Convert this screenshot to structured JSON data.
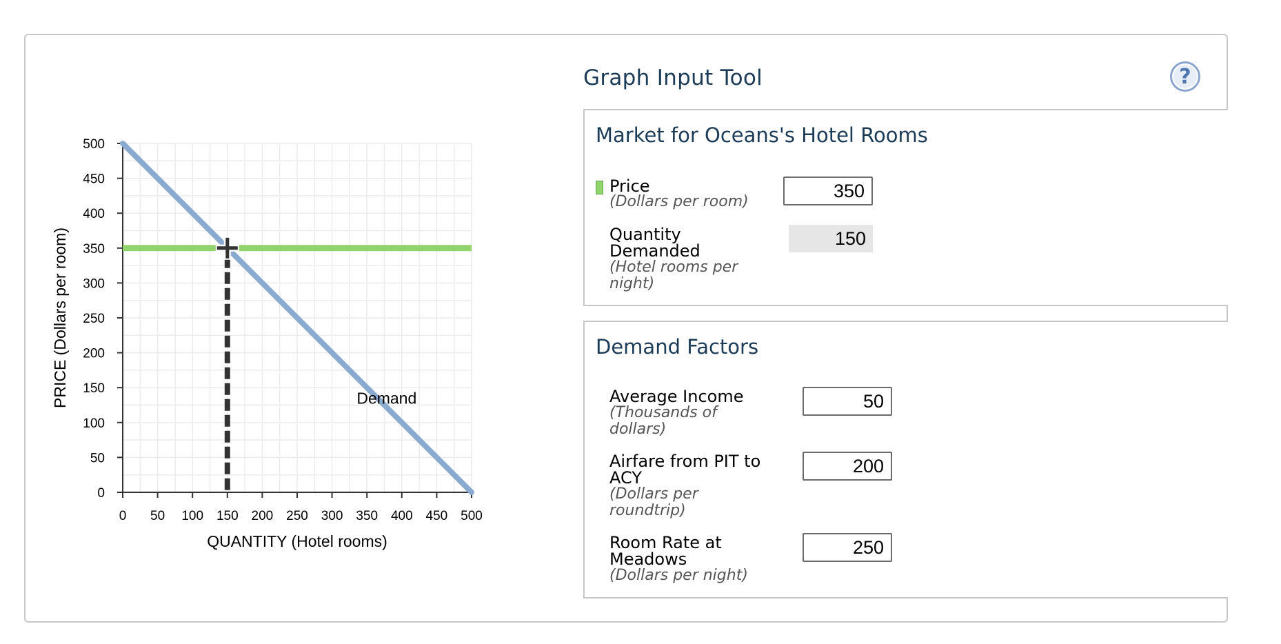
{
  "tool": {
    "title": "Graph Input Tool",
    "help_glyph": "?",
    "help_icon": "help-icon",
    "accent_color": "#1c3b57"
  },
  "market": {
    "title": "Market for Oceans's Hotel Rooms",
    "price_label": "Price",
    "price_unit": "(Dollars per room)",
    "price_value": "350",
    "qty_label_1": "Quantity",
    "qty_label_2": "Demanded",
    "qty_unit_1": "(Hotel rooms per",
    "qty_unit_2": "night)",
    "qty_value": "150",
    "price_swatch_color": "#8fd36b"
  },
  "demand_factors": {
    "title": "Demand Factors",
    "income_label": "Average Income",
    "income_unit_1": "(Thousands of",
    "income_unit_2": "dollars)",
    "income_value": "50",
    "airfare_label_1": "Airfare from PIT to",
    "airfare_label_2": "ACY",
    "airfare_unit_1": "(Dollars per",
    "airfare_unit_2": "roundtrip)",
    "airfare_value": "200",
    "room_label_1": "Room Rate at",
    "room_label_2": "Meadows",
    "room_unit": "(Dollars per night)",
    "room_value": "250"
  },
  "chart_data": {
    "type": "line",
    "xlabel": "QUANTITY (Hotel rooms)",
    "ylabel": "PRICE (Dollars per room)",
    "xlim": [
      0,
      500
    ],
    "ylim": [
      0,
      500
    ],
    "x_ticks": [
      0,
      50,
      100,
      150,
      200,
      250,
      300,
      350,
      400,
      450,
      500
    ],
    "y_ticks": [
      0,
      50,
      100,
      150,
      200,
      250,
      300,
      350,
      400,
      450,
      500
    ],
    "grid": true,
    "demand_line": {
      "name": "Demand",
      "points": [
        [
          0,
          500
        ],
        [
          500,
          0
        ]
      ],
      "label_at": [
        400,
        135
      ],
      "color": "#8aaad0"
    },
    "price_line": {
      "y": 350,
      "color": "#92d36e"
    },
    "point": {
      "x": 150,
      "y": 350,
      "color": "#333333"
    }
  }
}
